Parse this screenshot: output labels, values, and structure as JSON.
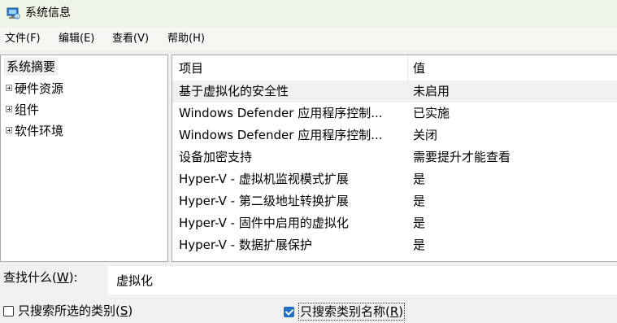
{
  "window": {
    "title": "系统信息",
    "app_icon": "system-info-icon"
  },
  "menu": [
    {
      "label": "文件(F)"
    },
    {
      "label": "编辑(E)"
    },
    {
      "label": "查看(V)"
    },
    {
      "label": "帮助(H)"
    }
  ],
  "tree": {
    "root": "系统摘要",
    "children": [
      {
        "label": "硬件资源"
      },
      {
        "label": "组件"
      },
      {
        "label": "软件环境"
      }
    ]
  },
  "list": {
    "columns": {
      "item": "项目",
      "value": "值"
    },
    "rows": [
      {
        "item": "基于虚拟化的安全性",
        "value": "未启用"
      },
      {
        "item": "Windows Defender 应用程序控制...",
        "value": "已实施"
      },
      {
        "item": "Windows Defender 应用程序控制...",
        "value": "关闭"
      },
      {
        "item": "设备加密支持",
        "value": "需要提升才能查看"
      },
      {
        "item": "Hyper-V - 虚拟机监视模式扩展",
        "value": "是"
      },
      {
        "item": "Hyper-V - 第二级地址转换扩展",
        "value": "是"
      },
      {
        "item": "Hyper-V - 固件中启用的虚拟化",
        "value": "是"
      },
      {
        "item": "Hyper-V - 数据扩展保护",
        "value": "是"
      }
    ],
    "selected_row_index": 0
  },
  "find": {
    "label_prefix": "查找什么(",
    "label_key": "W",
    "label_suffix": "):",
    "value": "虚拟化"
  },
  "options": {
    "selected_category_prefix": "只搜索所选的类别(",
    "selected_category_key": "S",
    "selected_category_suffix": ")",
    "selected_category_checked": false,
    "category_names_prefix": "只搜索类别名称(",
    "category_names_key": "R",
    "category_names_suffix": ")",
    "category_names_checked": true
  },
  "colors": {
    "titlebar_bg": "#eef5e6",
    "checkbox_accent": "#1f6fc5"
  }
}
